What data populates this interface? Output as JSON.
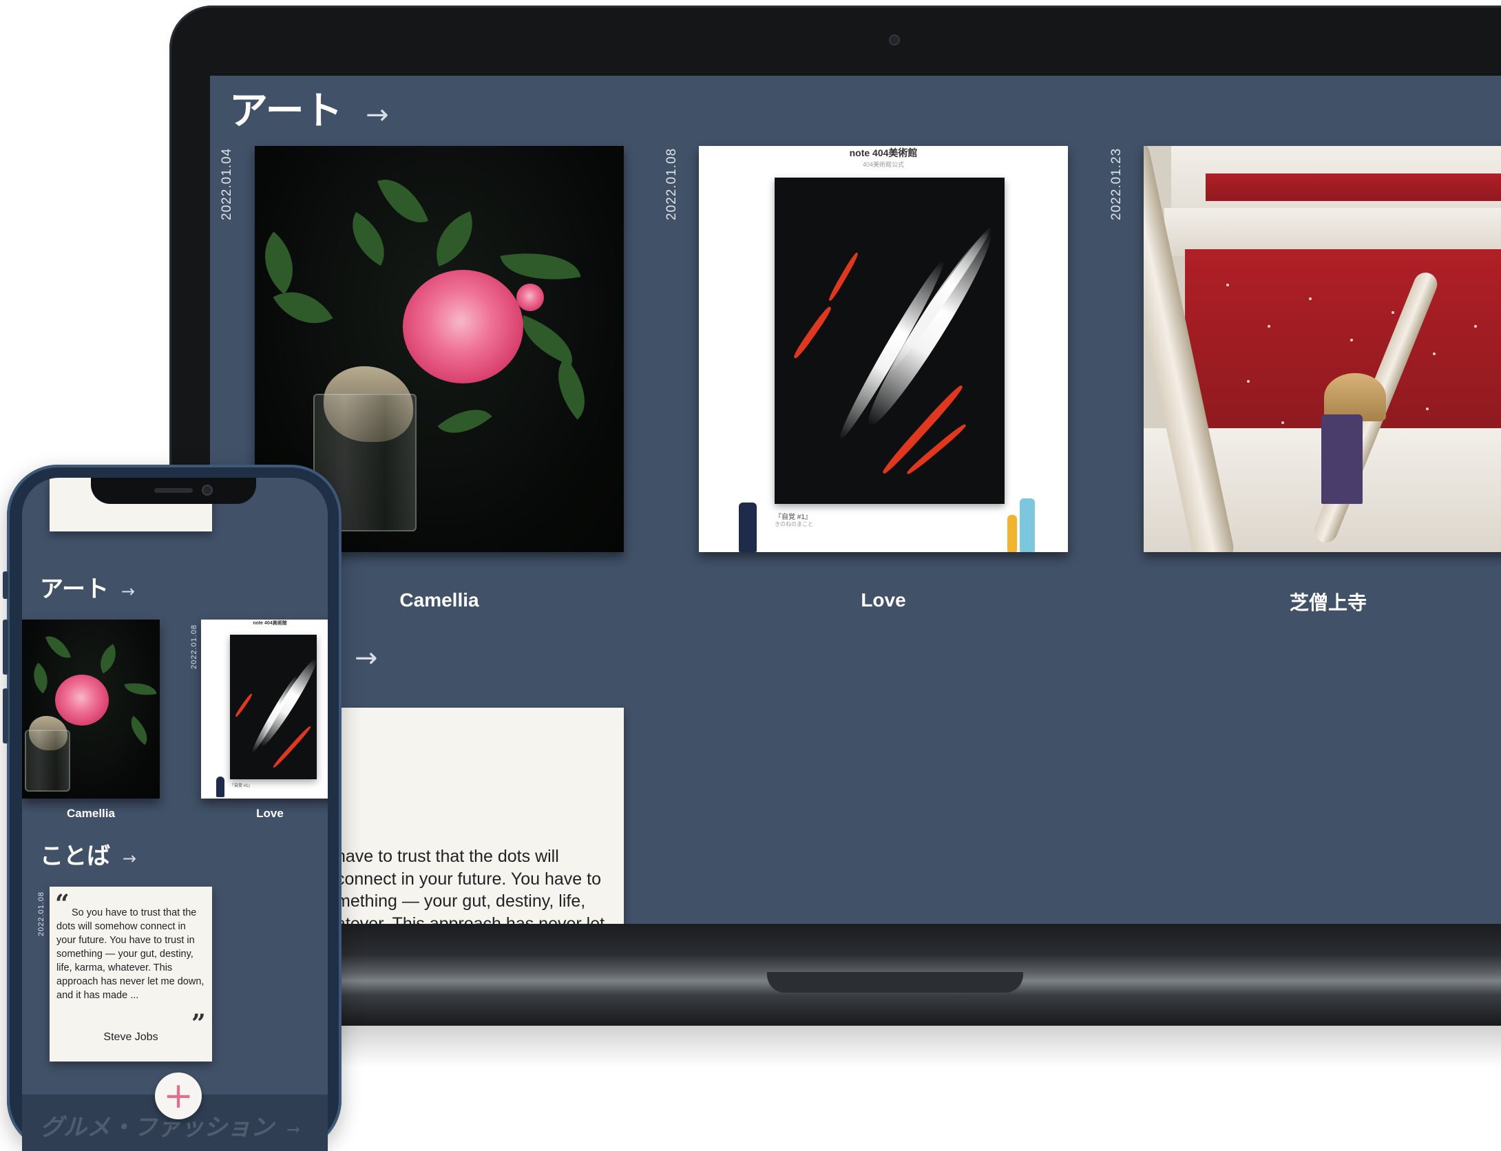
{
  "laptop": {
    "section_art": {
      "title": "アート",
      "arrow": "→",
      "cards": [
        {
          "date": "2022.01.04",
          "title": "Camellia"
        },
        {
          "date": "2022.01.08",
          "title": "Love",
          "poster_header": "note 404美術館",
          "poster_sub": "404美術館公式",
          "poster_caption": "『自覚 #1』",
          "poster_caption_sub": "きのねのまこと"
        },
        {
          "date": "2022.01.23",
          "title": "芝僧上寺"
        }
      ]
    },
    "section_words": {
      "arrow": "→",
      "quote_lines": [
        "have to trust that the dots will",
        "connect in your future. You have to",
        "mething — your gut, destiny, life,",
        "atever. This approach has never let"
      ]
    }
  },
  "phone": {
    "section_art": {
      "title": "アート",
      "arrow": "→",
      "cards": [
        {
          "title": "Camellia"
        },
        {
          "date": "2022.01.08",
          "title": "Love",
          "poster_header": "note 404美術館",
          "poster_caption": "『自覚 #1』"
        }
      ]
    },
    "section_words": {
      "title": "ことば",
      "arrow": "→",
      "date": "2022.01.08",
      "open_quote": "“",
      "close_quote": "”",
      "quote": "So you have to trust that the dots will somehow connect in your future. You have to trust in something — your gut, destiny, life, karma, whatever. This approach has never let me down, and it has made ...",
      "author": "Steve Jobs"
    },
    "fab_label": "+",
    "next_section_title": "グルメ・ファッション",
    "next_section_arrow": "→"
  },
  "colors": {
    "page_bg": "#415168",
    "card_bg": "#f6f4ef",
    "accent_pink": "#e1708e"
  }
}
